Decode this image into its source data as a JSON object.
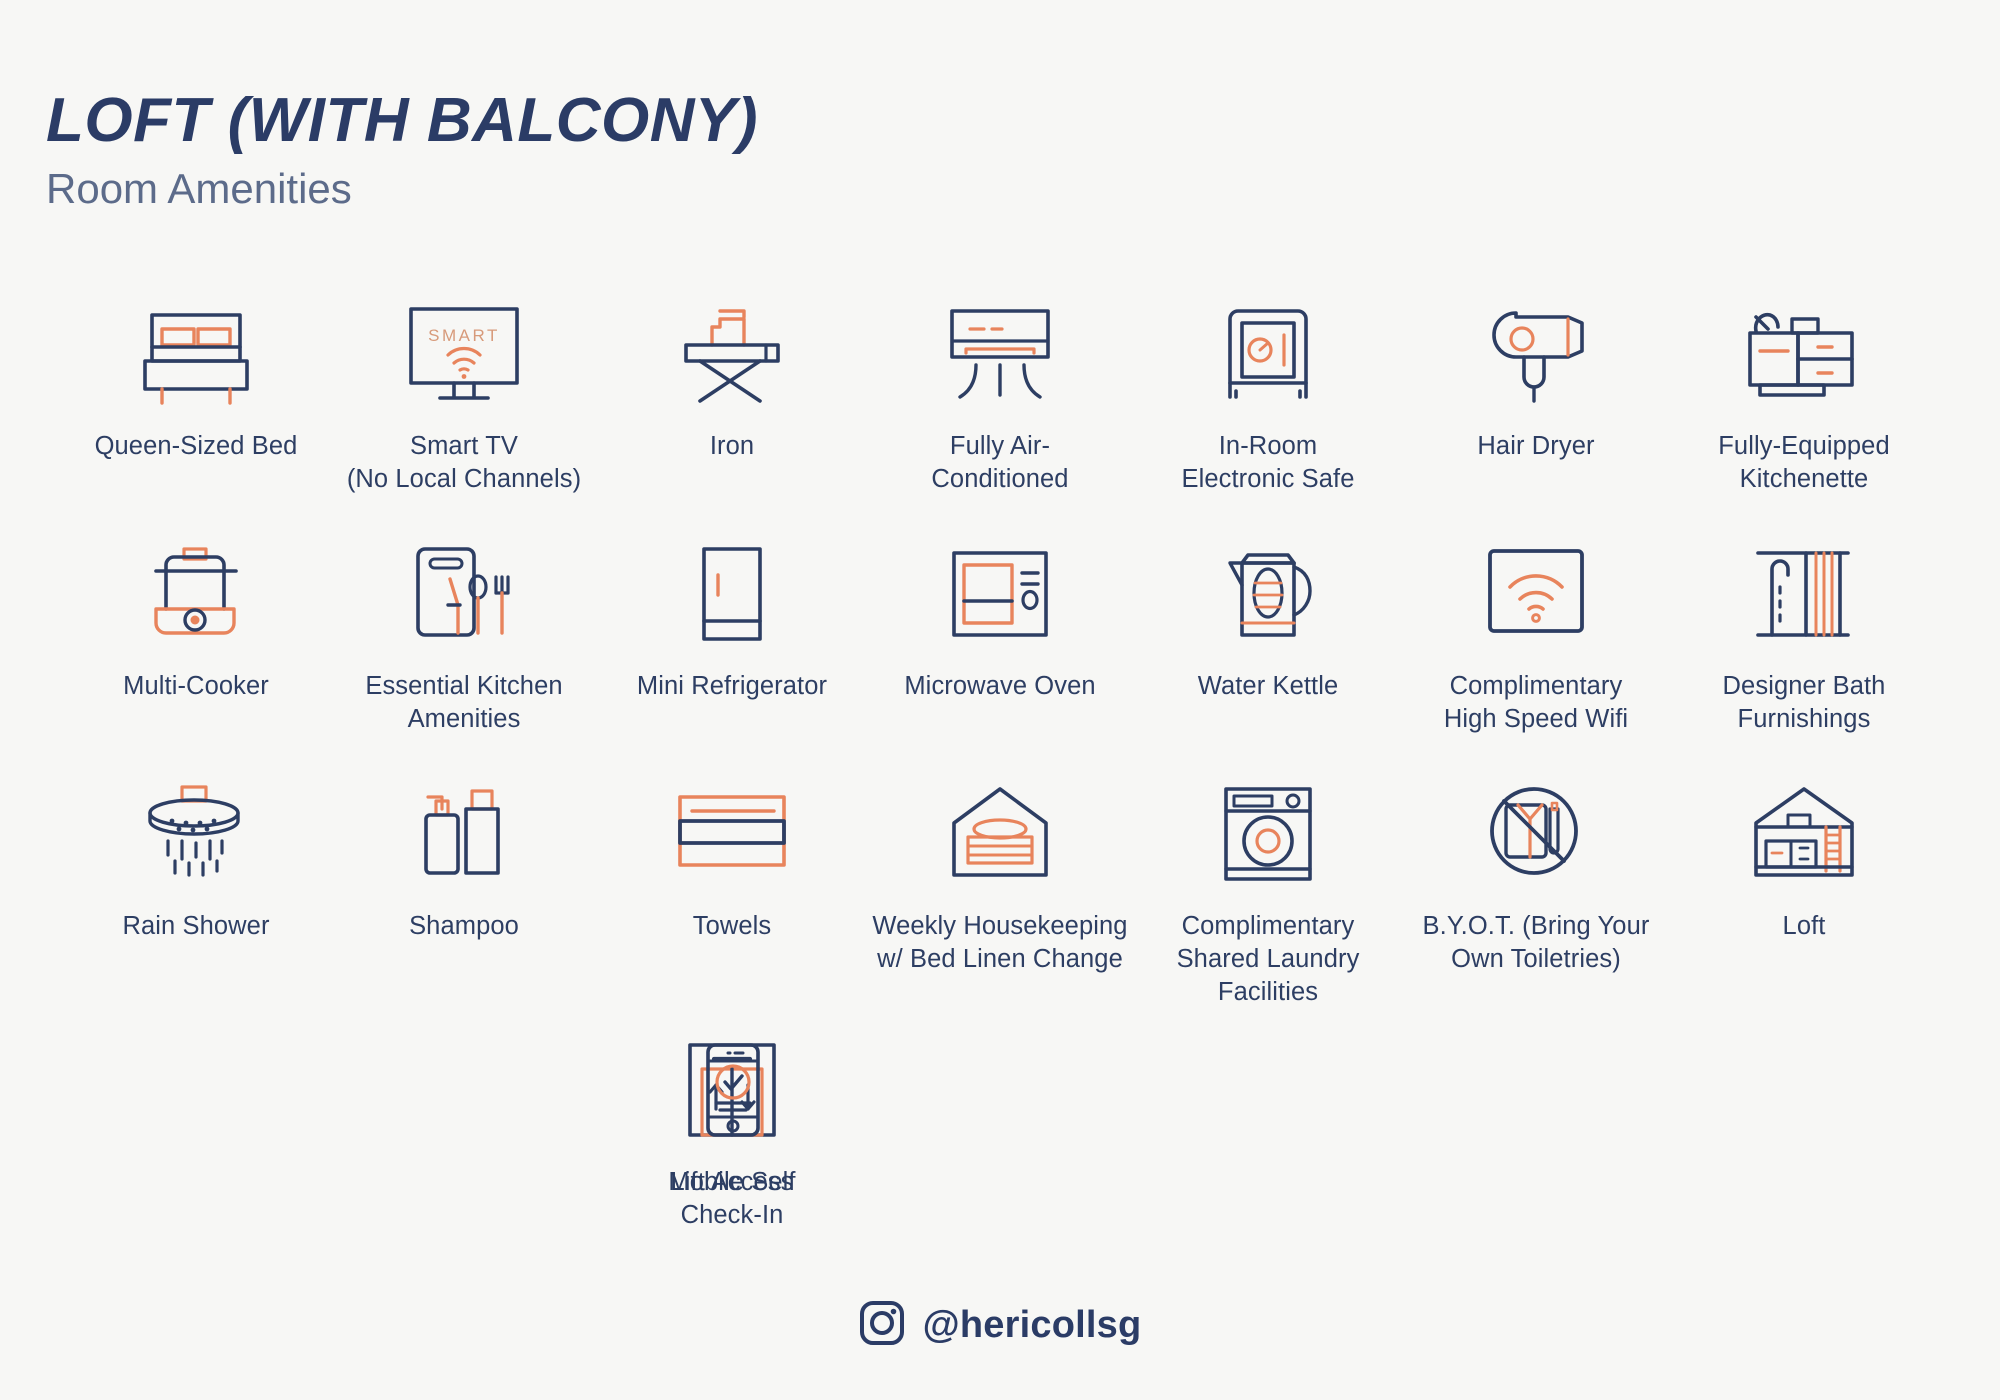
{
  "header": {
    "title": "LOFT (WITH BALCONY)",
    "subtitle": "Room Amenities"
  },
  "colors": {
    "background": "#f7f7f5",
    "navy": "#2d3e63",
    "orange": "#e8845c",
    "subtitle_gray": "#5c6b8a"
  },
  "rows": [
    {
      "items": [
        {
          "icon": "bed-icon",
          "label": "Queen-Sized Bed"
        },
        {
          "icon": "smart-tv-icon",
          "label": "Smart TV\n(No Local Channels)",
          "line1": "Smart TV",
          "line2": "(No Local Channels)"
        },
        {
          "icon": "iron-icon",
          "label": "Iron"
        },
        {
          "icon": "air-conditioner-icon",
          "label": "Fully Air-\nConditioned",
          "line1": "Fully Air-",
          "line2": "Conditioned"
        },
        {
          "icon": "safe-icon",
          "label": "In-Room\nElectronic Safe",
          "line1": "In-Room",
          "line2": "Electronic Safe"
        },
        {
          "icon": "hair-dryer-icon",
          "label": "Hair Dryer"
        },
        {
          "icon": "kitchenette-icon",
          "label": "Fully-Equipped\nKitchenette",
          "line1": "Fully-Equipped",
          "line2": "Kitchenette"
        }
      ]
    },
    {
      "items": [
        {
          "icon": "multi-cooker-icon",
          "label": "Multi-Cooker"
        },
        {
          "icon": "kitchen-utensils-icon",
          "label": "Essential Kitchen\nAmenities",
          "line1": "Essential Kitchen",
          "line2": "Amenities"
        },
        {
          "icon": "refrigerator-icon",
          "label": "Mini Refrigerator"
        },
        {
          "icon": "microwave-icon",
          "label": "Microwave Oven"
        },
        {
          "icon": "kettle-icon",
          "label": "Water Kettle"
        },
        {
          "icon": "wifi-icon",
          "label": "Complimentary\nHigh Speed Wifi",
          "line1": "Complimentary",
          "line2": "High Speed Wifi"
        },
        {
          "icon": "shower-curtain-icon",
          "label": "Designer Bath\nFurnishings",
          "line1": "Designer Bath",
          "line2": "Furnishings"
        }
      ]
    },
    {
      "items": [
        {
          "icon": "rain-shower-icon",
          "label": "Rain Shower"
        },
        {
          "icon": "shampoo-bottles-icon",
          "label": "Shampoo"
        },
        {
          "icon": "towels-icon",
          "label": "Towels"
        },
        {
          "icon": "housekeeping-linen-icon",
          "label": "Weekly Housekeeping\nw/ Bed Linen Change",
          "line1": "Weekly Housekeeping",
          "line2": "w/ Bed Linen Change"
        },
        {
          "icon": "washing-machine-icon",
          "label": "Complimentary\nShared Laundry\nFacilities",
          "line1": "Complimentary",
          "line2": "Shared Laundry",
          "line3": "Facilities"
        },
        {
          "icon": "no-toiletries-icon",
          "label": "B.Y.O.T. (Bring Your\nOwn Toiletries)",
          "line1": "B.Y.O.T. (Bring Your",
          "line2": "Own Toiletries)"
        },
        {
          "icon": "loft-house-icon",
          "label": "Loft"
        }
      ]
    },
    {
      "items": [
        {
          "icon": "lift-icon",
          "label": "Lift Access"
        },
        {
          "icon": "mobile-checkin-icon",
          "label": "Mobile Self\nCheck-In",
          "line1": "Mobile Self",
          "line2": "Check-In"
        }
      ]
    }
  ],
  "footer": {
    "icon": "instagram-icon",
    "handle": "@hericollsg"
  }
}
